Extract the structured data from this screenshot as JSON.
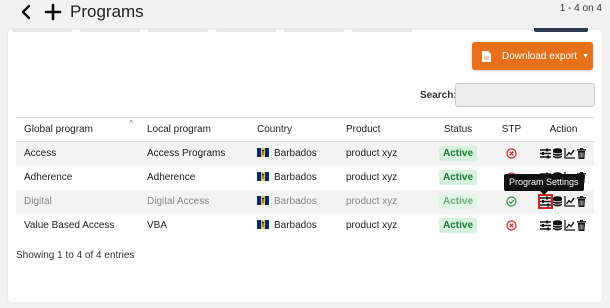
{
  "header": {
    "title": "Programs",
    "pager_count": "1 - 4 on 4"
  },
  "export_button": {
    "label": "Download export"
  },
  "search": {
    "label": "Search:",
    "value": ""
  },
  "table": {
    "columns": [
      "Global program",
      "Local program",
      "Country",
      "Product",
      "Status",
      "STP",
      "Action"
    ],
    "rows": [
      {
        "global": "Access",
        "local": "Access Programs",
        "country": "Barbados",
        "product": "product xyz",
        "status": "Active",
        "stp": "x-circle"
      },
      {
        "global": "Adherence",
        "local": "Adherence",
        "country": "Barbados",
        "product": "product xyz",
        "status": "Active",
        "stp": "x-circle"
      },
      {
        "global": "Digital",
        "local": "Digital Access",
        "country": "Barbados",
        "product": "product xyz",
        "status": "Active",
        "stp": "check-circle"
      },
      {
        "global": "Value Based Access",
        "local": "VBA",
        "country": "Barbados",
        "product": "product xyz",
        "status": "Active",
        "stp": "x-circle"
      }
    ]
  },
  "tooltip": {
    "text": "Program Settings"
  },
  "footer": {
    "showing": "Showing 1 to 4 of 4 entries"
  },
  "colors": {
    "accent": "#e8701a",
    "status_bg": "#d6f2dc",
    "status_fg": "#1a7a37",
    "error": "#d32020",
    "ok": "#2a9a4a"
  },
  "icons": {
    "back": "chevron-left-icon",
    "add": "plus-icon",
    "export": "file-icon",
    "actions": [
      "sliders-icon",
      "database-icon",
      "chart-icon",
      "trash-icon"
    ]
  }
}
